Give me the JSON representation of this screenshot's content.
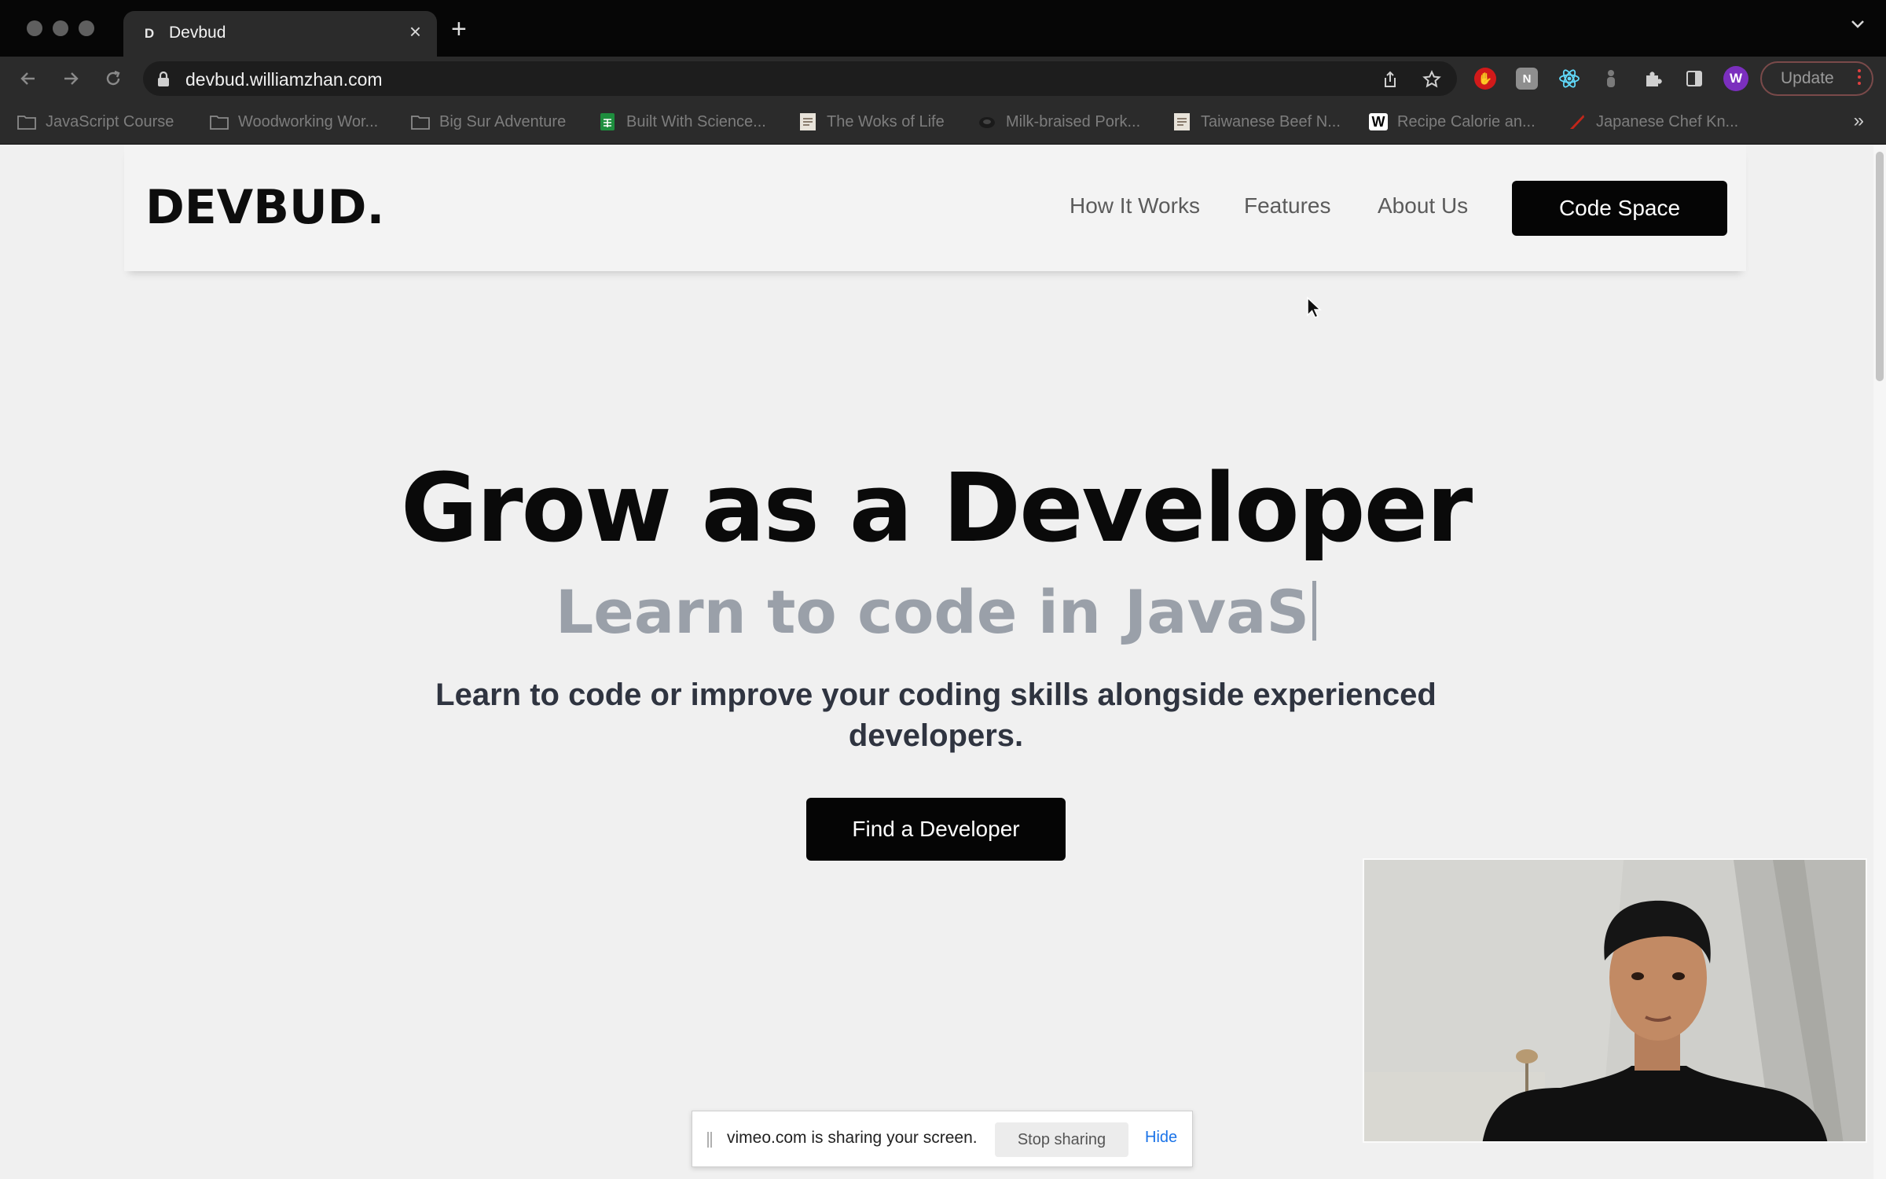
{
  "browser": {
    "tab": {
      "favicon_letter": "D",
      "title": "Devbud"
    },
    "url": "devbud.williamzhan.com",
    "profile_initial": "W",
    "update_label": "Update",
    "bookmarks": [
      {
        "label": "JavaScript Course",
        "icon": "folder-icon"
      },
      {
        "label": "Woodworking Wor...",
        "icon": "folder-icon"
      },
      {
        "label": "Big Sur Adventure",
        "icon": "folder-icon"
      },
      {
        "label": "Built With Science...",
        "icon": "sheets-icon"
      },
      {
        "label": "The Woks of Life",
        "icon": "site-favicon"
      },
      {
        "label": "Milk-braised Pork...",
        "icon": "site-favicon"
      },
      {
        "label": "Taiwanese Beef N...",
        "icon": "site-favicon"
      },
      {
        "label": "Recipe Calorie an...",
        "icon": "w-favicon"
      },
      {
        "label": "Japanese Chef Kn...",
        "icon": "knife-favicon"
      }
    ]
  },
  "site": {
    "logo": "DEVBUD.",
    "nav": [
      "How It Works",
      "Features",
      "About Us"
    ],
    "cta_top": "Code Space",
    "hero": {
      "title": "Grow as a Developer",
      "typing_prefix": "Learn to code in",
      "typing_word": "JavaS",
      "subtitle_line1": "Learn to code or improve your coding skills alongside experienced",
      "subtitle_line2": "developers.",
      "cta": "Find a Developer"
    }
  },
  "share_bar": {
    "message": "vimeo.com is sharing your screen.",
    "stop_label": "Stop sharing",
    "hide_label": "Hide"
  },
  "colors": {
    "chrome_bg": "#2b2b2b",
    "tabstrip_bg": "#060606",
    "page_bg": "#f0f0f0",
    "button_bg": "#050505",
    "typing_gray": "#9aa0a9",
    "link_blue": "#1a73e8"
  }
}
